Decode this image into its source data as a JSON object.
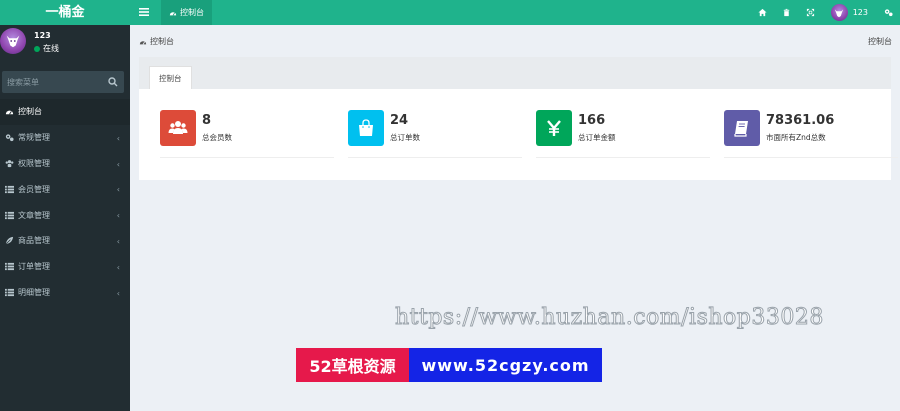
{
  "app": {
    "logo": "一桶金"
  },
  "user": {
    "name": "123",
    "status": "在线"
  },
  "sidebar": {
    "search_placeholder": "搜索菜单",
    "items": [
      {
        "label": "控制台",
        "icon": "dashboard-icon",
        "active": true
      },
      {
        "label": "常规管理",
        "icon": "cogs-icon"
      },
      {
        "label": "权限管理",
        "icon": "group-icon"
      },
      {
        "label": "会员管理",
        "icon": "list-icon"
      },
      {
        "label": "文章管理",
        "icon": "list-icon"
      },
      {
        "label": "商品管理",
        "icon": "leaf-icon"
      },
      {
        "label": "订单管理",
        "icon": "list-icon"
      },
      {
        "label": "明细管理",
        "icon": "list-icon"
      }
    ]
  },
  "topbar": {
    "tab": "控制台",
    "username": "123"
  },
  "breadcrumb": {
    "left": "控制台",
    "right": "控制台"
  },
  "panel": {
    "tab": "控制台"
  },
  "stats": [
    {
      "value": "8",
      "label": "总会员数",
      "color": "#dd4b39",
      "icon": "users-icon"
    },
    {
      "value": "24",
      "label": "总订单数",
      "color": "#00c0ef",
      "icon": "shopping-bag-icon"
    },
    {
      "value": "166",
      "label": "总订单金额",
      "color": "#00a65a",
      "icon": "yen-icon"
    },
    {
      "value": "78361.06",
      "label": "市面所有Znd总数",
      "color": "#605ca8",
      "icon": "book-icon"
    }
  ],
  "watermark": {
    "url": "https://www.huzhan.com/ishop33028",
    "banner_left": "52草根资源",
    "banner_right": "www.52cgzy.com"
  }
}
